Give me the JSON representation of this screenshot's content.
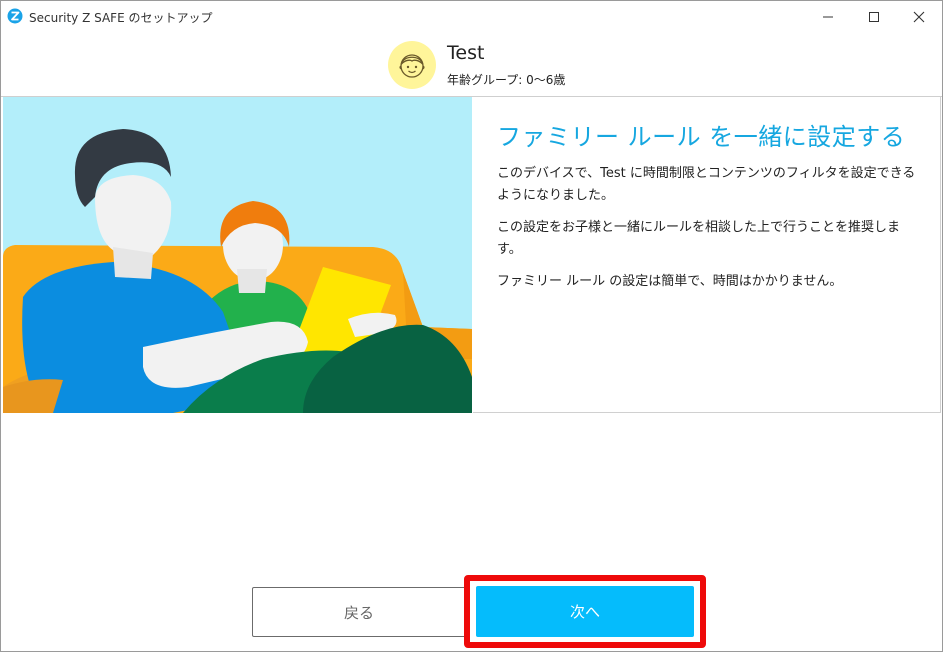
{
  "window": {
    "title": "Security Z SAFE のセットアップ",
    "minimize_icon": "minimize-icon",
    "maximize_icon": "maximize-icon",
    "close_icon": "close-icon"
  },
  "profile": {
    "name": "Test",
    "age_group": "年齢グループ: 0〜6歳",
    "avatar_icon": "child-face-icon"
  },
  "content": {
    "heading": "ファミリー ルール を一緒に設定する",
    "paragraph1": "このデバイスで、Test に時間制限とコンテンツのフィルタを設定できるようになりました。",
    "paragraph2": "この設定をお子様と一緒にルールを相談した上で行うことを推奨します。",
    "paragraph3": "ファミリー ルール の設定は簡単で、時間はかかりません。",
    "illustration": "parent-and-child-with-tablet-illustration"
  },
  "buttons": {
    "back": "戻る",
    "next": "次へ"
  },
  "colors": {
    "accent": "#05bcfc",
    "heading": "#16a7e0",
    "highlight": "#ee0a0a",
    "avatar_bg": "#fff59a"
  }
}
